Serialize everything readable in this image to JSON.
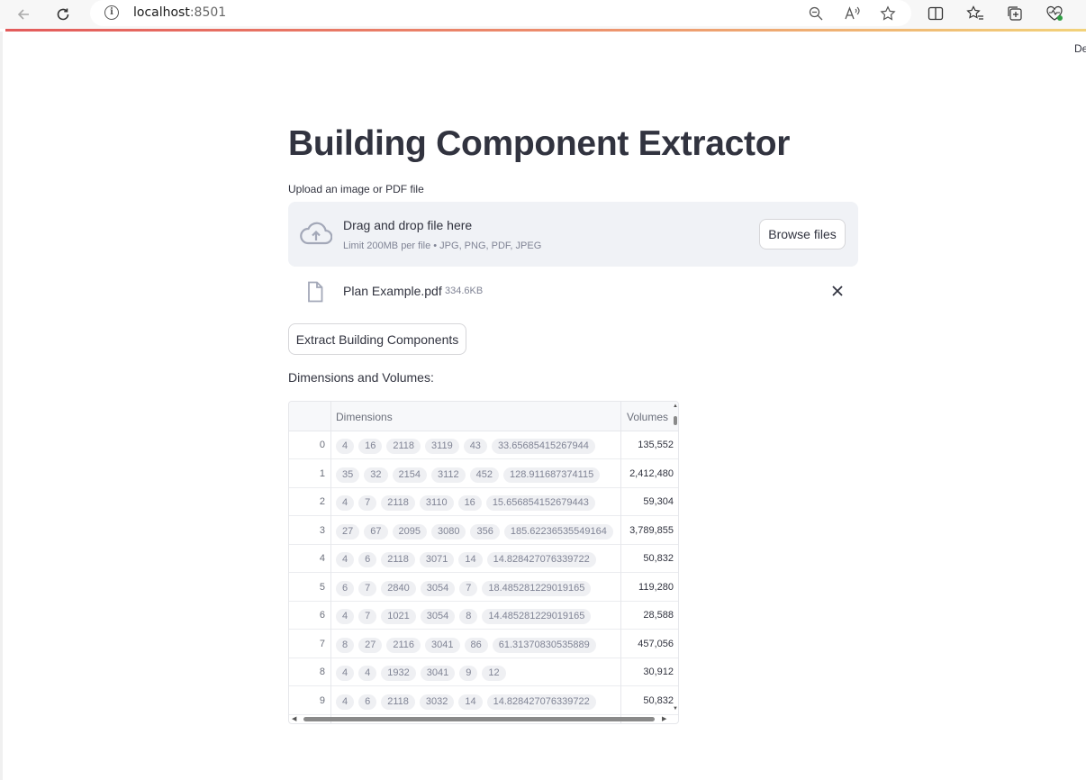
{
  "browser": {
    "url_host": "localhost",
    "url_port": ":8501"
  },
  "deploy_label": "De",
  "app": {
    "title": "Building Component Extractor",
    "upload_label": "Upload an image or PDF file",
    "dropzone": {
      "text": "Drag and drop file here",
      "limit": "Limit 200MB per file • JPG, PNG, PDF, JPEG",
      "browse_label": "Browse files"
    },
    "uploaded_file": {
      "name": "Plan Example.pdf",
      "size": "334.6KB"
    },
    "extract_label": "Extract Building Components",
    "results_label": "Dimensions and Volumes:"
  },
  "table": {
    "columns": [
      "",
      "Dimensions",
      "Volumes"
    ],
    "rows": [
      {
        "index": "0",
        "dimensions": [
          "4",
          "16",
          "2118",
          "3119",
          "43",
          "33.65685415267944"
        ],
        "volume": "135,552"
      },
      {
        "index": "1",
        "dimensions": [
          "35",
          "32",
          "2154",
          "3112",
          "452",
          "128.911687374115"
        ],
        "volume": "2,412,480"
      },
      {
        "index": "2",
        "dimensions": [
          "4",
          "7",
          "2118",
          "3110",
          "16",
          "15.656854152679443"
        ],
        "volume": "59,304"
      },
      {
        "index": "3",
        "dimensions": [
          "27",
          "67",
          "2095",
          "3080",
          "356",
          "185.62236535549164"
        ],
        "volume": "3,789,855"
      },
      {
        "index": "4",
        "dimensions": [
          "4",
          "6",
          "2118",
          "3071",
          "14",
          "14.828427076339722"
        ],
        "volume": "50,832"
      },
      {
        "index": "5",
        "dimensions": [
          "6",
          "7",
          "2840",
          "3054",
          "7",
          "18.485281229019165"
        ],
        "volume": "119,280"
      },
      {
        "index": "6",
        "dimensions": [
          "4",
          "7",
          "1021",
          "3054",
          "8",
          "14.485281229019165"
        ],
        "volume": "28,588"
      },
      {
        "index": "7",
        "dimensions": [
          "8",
          "27",
          "2116",
          "3041",
          "86",
          "61.31370830535889"
        ],
        "volume": "457,056"
      },
      {
        "index": "8",
        "dimensions": [
          "4",
          "4",
          "1932",
          "3041",
          "9",
          "12"
        ],
        "volume": "30,912"
      },
      {
        "index": "9",
        "dimensions": [
          "4",
          "6",
          "2118",
          "3032",
          "14",
          "14.828427076339722"
        ],
        "volume": "50,832"
      }
    ]
  }
}
